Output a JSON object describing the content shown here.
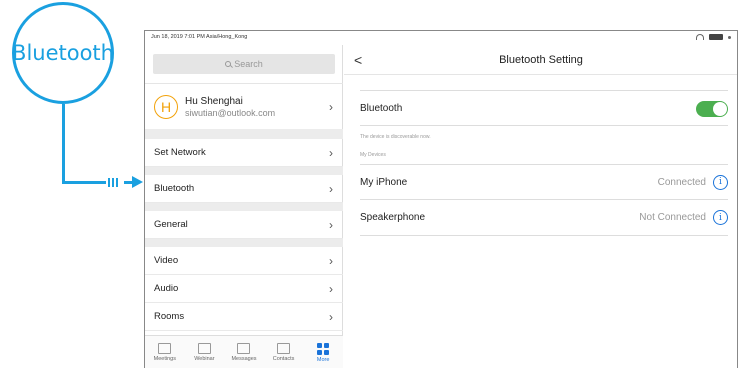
{
  "callout": {
    "label": "Bluetooth"
  },
  "status_bar": {
    "time": "Jun 18, 2019 7:01 PM Asia/Hong_Kong"
  },
  "sidebar": {
    "search_placeholder": "Search",
    "profile": {
      "initial": "H",
      "name": "Hu Shenghai",
      "email": "siwutian@outlook.com"
    },
    "items": [
      {
        "label": "Set Network"
      },
      {
        "label": "Bluetooth"
      },
      {
        "label": "General"
      },
      {
        "label": "Video"
      },
      {
        "label": "Audio"
      },
      {
        "label": "Rooms"
      }
    ],
    "nav": [
      {
        "label": "Meetings"
      },
      {
        "label": "Webinar"
      },
      {
        "label": "Messages"
      },
      {
        "label": "Contacts"
      },
      {
        "label": "More"
      }
    ]
  },
  "bluetooth_setting": {
    "title": "Bluetooth Setting",
    "back": "<",
    "toggle_label": "Bluetooth",
    "toggle_on": true,
    "discoverable_note": "The device is discoverable now.",
    "my_devices_heading": "My Devices",
    "devices": [
      {
        "name": "My iPhone",
        "status": "Connected"
      },
      {
        "name": "Speakerphone",
        "status": "Not Connected"
      }
    ]
  },
  "colors": {
    "accent": "#1aa0e0",
    "toggle": "#4caf50",
    "active_nav": "#1a73d9",
    "avatar": "#f2a20a"
  }
}
